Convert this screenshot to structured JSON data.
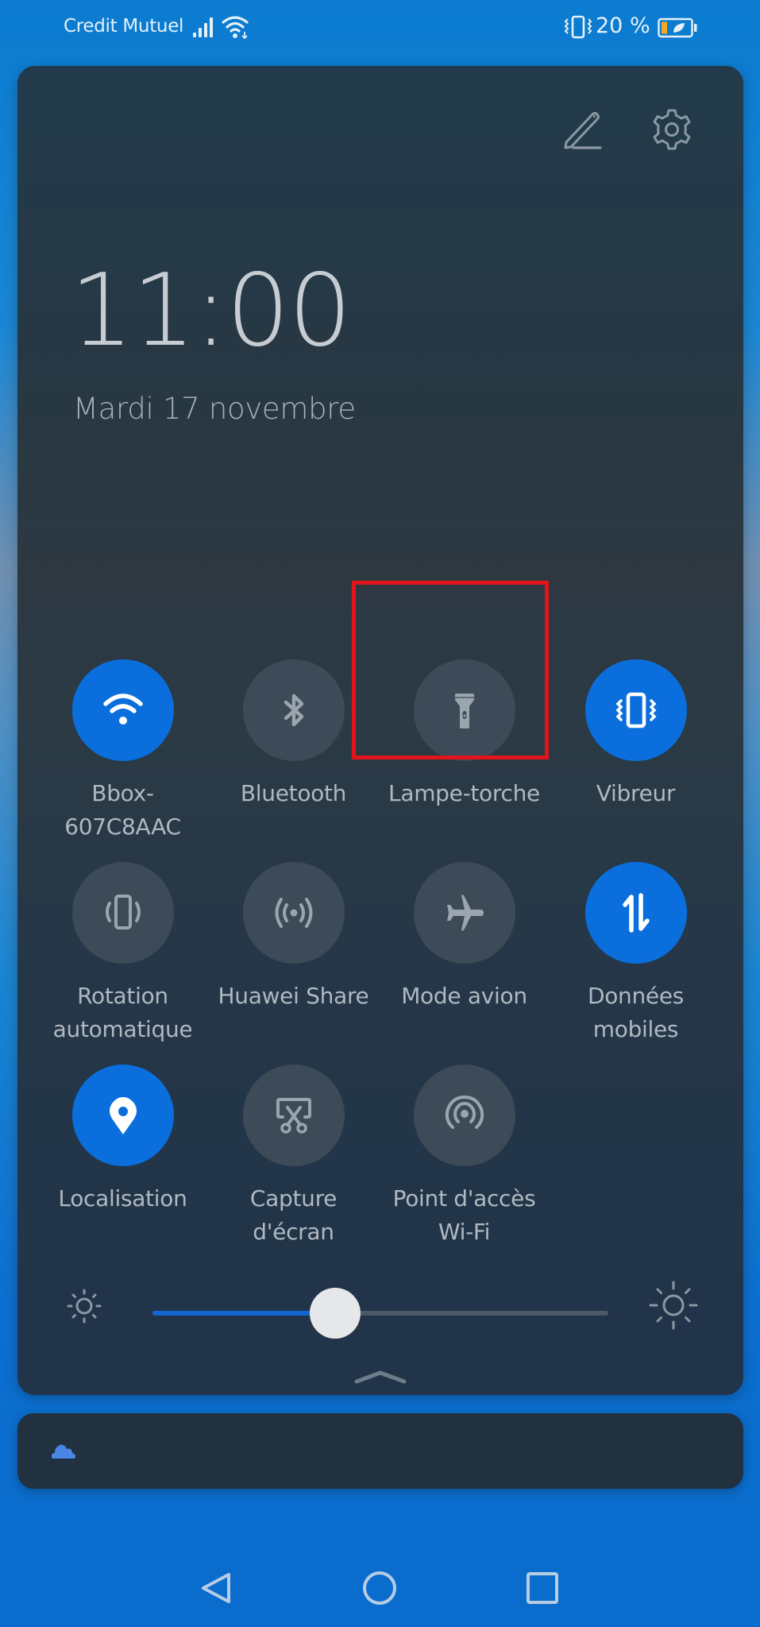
{
  "status_bar": {
    "carrier": "Credit Mutuel",
    "signal_icon": "cell-signal-icon",
    "wifi_icon": "wifi-icon",
    "vibrate_icon": "vibrate-mode-icon",
    "battery_percent": "20 %",
    "battery_level": 0.2,
    "battery_saver": true,
    "colors": {
      "battery_fill": "#f5a623"
    }
  },
  "panel": {
    "edit_icon": "pencil-edit-icon",
    "settings_icon": "gear-icon",
    "clock": "11:00",
    "date": "Mardi 17 novembre"
  },
  "tiles": [
    {
      "id": "wifi",
      "label": "Bbox-\n607C8AAC",
      "icon": "wifi-icon",
      "on": true
    },
    {
      "id": "bluetooth",
      "label": "Bluetooth",
      "icon": "bluetooth-icon",
      "on": false
    },
    {
      "id": "flashlight",
      "label": "Lampe-torche",
      "icon": "flashlight-icon",
      "on": false,
      "highlighted": true
    },
    {
      "id": "vibrate",
      "label": "Vibreur",
      "icon": "vibrate-icon",
      "on": true
    },
    {
      "id": "auto-rotate",
      "label": "Rotation\nautomatique",
      "icon": "auto-rotate-icon",
      "on": false
    },
    {
      "id": "huawei-share",
      "label": "Huawei Share",
      "icon": "huawei-share-icon",
      "on": false
    },
    {
      "id": "airplane",
      "label": "Mode avion",
      "icon": "airplane-icon",
      "on": false
    },
    {
      "id": "mobile-data",
      "label": "Données\nmobiles",
      "icon": "mobile-data-icon",
      "on": true
    },
    {
      "id": "location",
      "label": "Localisation",
      "icon": "location-pin-icon",
      "on": true
    },
    {
      "id": "screenshot",
      "label": "Capture\nd'écran",
      "icon": "screenshot-icon",
      "on": false
    },
    {
      "id": "hotspot",
      "label": "Point d'accès\nWi-Fi",
      "icon": "hotspot-icon",
      "on": false
    }
  ],
  "brightness": {
    "value_percent": 40,
    "low_icon": "brightness-low-icon",
    "high_icon": "brightness-high-icon"
  },
  "notification": {
    "icon": "cloud-icon"
  },
  "nav": {
    "back_icon": "back-triangle-icon",
    "home_icon": "home-circle-icon",
    "recents_icon": "recents-square-icon"
  },
  "colors": {
    "accent_on": "#0a6fdc",
    "tile_off": "#3c4b57",
    "highlight_box": "#e3141c",
    "slider_fill": "#1266d2"
  }
}
